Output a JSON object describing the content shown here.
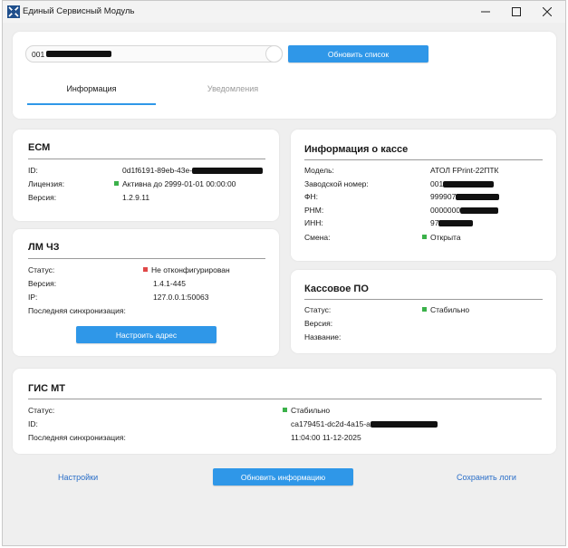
{
  "window": {
    "title": "Единый Сервисный Модуль"
  },
  "top": {
    "device_input_value": "001",
    "refresh_list_label": "Обновить список",
    "tabs": [
      {
        "label": "Информация",
        "active": true
      },
      {
        "label": "Уведомления",
        "active": false
      }
    ]
  },
  "esm": {
    "title": "ЕСМ",
    "id_label": "ID:",
    "id_value": "0d1f6191-89eb-43e-",
    "license_label": "Лицензия:",
    "license_value": "Активна до 2999-01-01 00:00:00",
    "version_label": "Версия:",
    "version_value": "1.2.9.11"
  },
  "lm": {
    "title": "ЛМ ЧЗ",
    "status_label": "Статус:",
    "status_value": "Не отконфигурирован",
    "version_label": "Версия:",
    "version_value": "1.4.1-445",
    "ip_label": "IP:",
    "ip_value": "127.0.0.1:50063",
    "sync_label": "Последняя синхронизация:",
    "sync_value": "",
    "configure_label": "Настроить адрес"
  },
  "kassa": {
    "title": "Информация о кассе",
    "model_label": "Модель:",
    "model_value": "АТОЛ FPrint-22ПТК",
    "serial_label": "Заводской номер:",
    "serial_value": "001",
    "fn_label": "ФН:",
    "fn_value": "999907",
    "rnm_label": "РНМ:",
    "rnm_value": "0000000",
    "inn_label": "ИНН:",
    "inn_value": "97",
    "shift_label": "Смена:",
    "shift_value": "Открыта"
  },
  "po": {
    "title": "Кассовое ПО",
    "status_label": "Статус:",
    "status_value": "Стабильно",
    "version_label": "Версия:",
    "version_value": "",
    "name_label": "Название:",
    "name_value": ""
  },
  "gis": {
    "title": "ГИС МТ",
    "status_label": "Статус:",
    "status_value": "Стабильно",
    "id_label": "ID:",
    "id_value": "ca179451-dc2d-4a15-a",
    "sync_label": "Последняя синхронизация:",
    "sync_value": "11:04:00 11-12-2025"
  },
  "footer": {
    "settings_label": "Настройки",
    "refresh_info_label": "Обновить информацию",
    "save_logs_label": "Сохранить логи"
  },
  "colors": {
    "accent": "#2f97e8",
    "ok": "#3bb14a",
    "error": "#e04848",
    "link": "#2a6ec8"
  }
}
